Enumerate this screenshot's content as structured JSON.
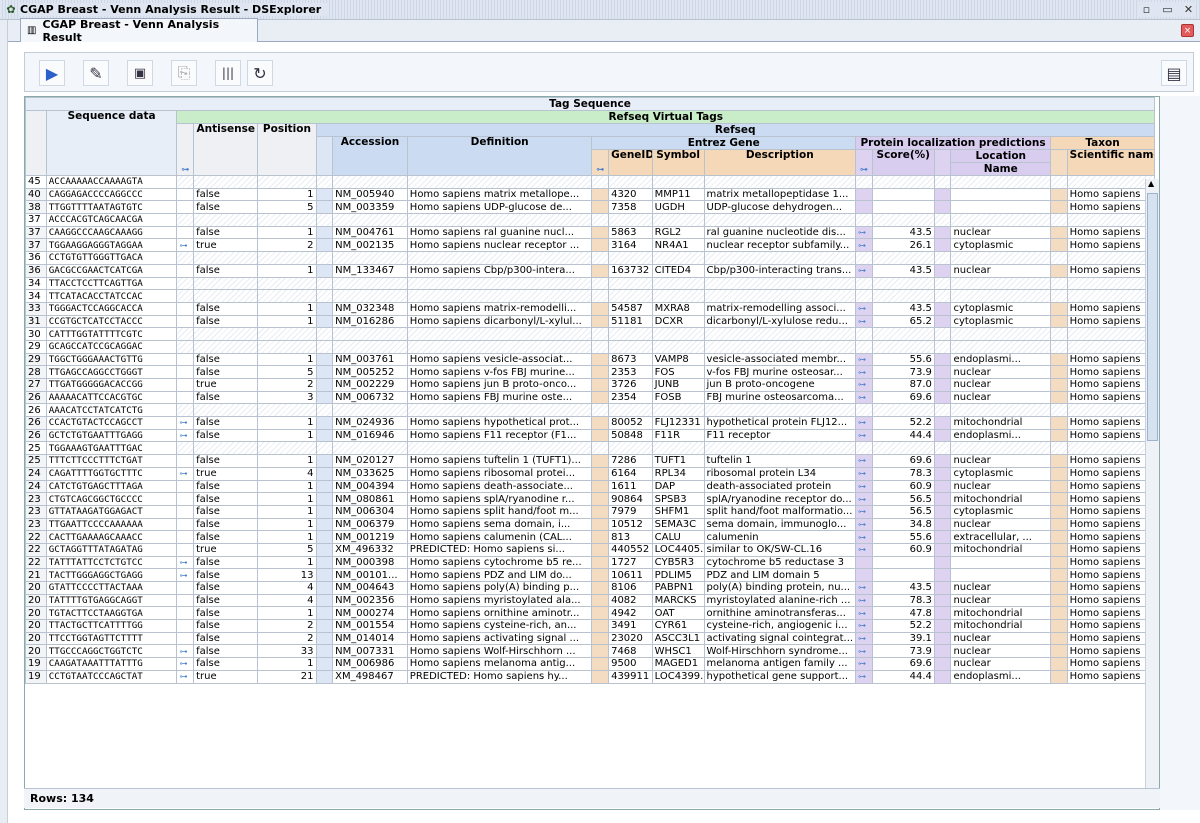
{
  "window": {
    "title": "CGAP Breast - Venn Analysis Result - DSExplorer"
  },
  "tab": {
    "label": "CGAP Breast - Venn Analysis Result"
  },
  "toolbar": {
    "buttons": [
      {
        "name": "run-icon",
        "glyph": "▶"
      },
      {
        "name": "edit-icon",
        "glyph": "✎"
      },
      {
        "name": "save-icon",
        "glyph": "💾"
      },
      {
        "name": "copy-icon",
        "glyph": "⎘"
      },
      {
        "name": "barcode-icon",
        "glyph": "|||"
      },
      {
        "name": "refresh-icon",
        "glyph": "↻"
      }
    ],
    "panel_icon": "▤"
  },
  "headers": {
    "tag_sequence": "Tag Sequence",
    "sequence_data": "Sequence data",
    "refseq_virtual_tags": "Refseq Virtual Tags",
    "antisense": "Antisense",
    "position": "Position",
    "refseq": "Refseq",
    "accession": "Accession",
    "definition": "Definition",
    "entrez_gene": "Entrez Gene",
    "geneid": "GeneID",
    "symbol": "Symbol",
    "description": "Description",
    "protein_loc": "Protein localization predictions",
    "score": "Score(%)",
    "location": "Location",
    "name": "Name",
    "taxon": "Taxon",
    "scientific_name": "Scientific name"
  },
  "rows": [
    [
      "45",
      "ACCAAAAACCAAAAGTA",
      "",
      "",
      "",
      "",
      "",
      "",
      "",
      "",
      "",
      "",
      ""
    ],
    [
      "40",
      "CAGGAGACCCCAGGCCC",
      "false",
      "1",
      "NM_005940",
      "Homo sapiens matrix metallope...",
      "4320",
      "MMP11",
      "matrix metallopeptidase 1...",
      "",
      "",
      "",
      "Homo sapiens"
    ],
    [
      "38",
      "TTGGTTTTAATAGTGTC",
      "false",
      "5",
      "NM_003359",
      "Homo sapiens UDP-glucose de...",
      "7358",
      "UGDH",
      "UDP-glucose dehydrogen...",
      "",
      "",
      "",
      "Homo sapiens"
    ],
    [
      "37",
      "ACCCACGTCAGCAACGA",
      "",
      "",
      "",
      "",
      "",
      "",
      "",
      "",
      "",
      "",
      ""
    ],
    [
      "37",
      "CAAGGCCCAAGCAAAGG",
      "false",
      "1",
      "NM_004761",
      "Homo sapiens ral guanine nucl...",
      "5863",
      "RGL2",
      "ral guanine nucleotide dis...",
      "k",
      "43.5",
      "nuclear",
      "Homo sapiens"
    ],
    [
      "37",
      "TGGAAGGAGGGTAGGAA",
      "true",
      "2",
      "NM_002135",
      "Homo sapiens nuclear receptor ...",
      "3164",
      "NR4A1",
      "nuclear receptor subfamily...",
      "k",
      "26.1",
      "cytoplasmic",
      "Homo sapiens"
    ],
    [
      "36",
      "CCTGTGTTGGGTTGACA",
      "",
      "",
      "",
      "",
      "",
      "",
      "",
      "",
      "",
      "",
      ""
    ],
    [
      "36",
      "GACGCCGAACTCATCGA",
      "false",
      "1",
      "NM_133467",
      "Homo sapiens Cbp/p300-intera...",
      "163732",
      "CITED4",
      "Cbp/p300-interacting trans...",
      "k",
      "43.5",
      "nuclear",
      "Homo sapiens"
    ],
    [
      "34",
      "TTACCTCCTTCAGTTGA",
      "",
      "",
      "",
      "",
      "",
      "",
      "",
      "",
      "",
      "",
      ""
    ],
    [
      "34",
      "TTCATACACCTATCCAC",
      "",
      "",
      "",
      "",
      "",
      "",
      "",
      "",
      "",
      "",
      ""
    ],
    [
      "33",
      "TGGGACTCCAGGCACCA",
      "false",
      "1",
      "NM_032348",
      "Homo sapiens matrix-remodelli...",
      "54587",
      "MXRA8",
      "matrix-remodelling associ...",
      "k",
      "43.5",
      "cytoplasmic",
      "Homo sapiens"
    ],
    [
      "31",
      "CCGTGCTCATCCTACCC",
      "false",
      "1",
      "NM_016286",
      "Homo sapiens dicarbonyl/L-xylul...",
      "51181",
      "DCXR",
      "dicarbonyl/L-xylulose redu...",
      "k",
      "65.2",
      "cytoplasmic",
      "Homo sapiens"
    ],
    [
      "30",
      "CATTTGGTATTTTCGTC",
      "",
      "",
      "",
      "",
      "",
      "",
      "",
      "",
      "",
      "",
      ""
    ],
    [
      "29",
      "GCAGCCATCCGCAGGAC",
      "",
      "",
      "",
      "",
      "",
      "",
      "",
      "",
      "",
      "",
      ""
    ],
    [
      "29",
      "TGGCTGGGAAACTGTTG",
      "false",
      "1",
      "NM_003761",
      "Homo sapiens vesicle-associat...",
      "8673",
      "VAMP8",
      "vesicle-associated membr...",
      "k",
      "55.6",
      "endoplasmi...",
      "Homo sapiens"
    ],
    [
      "28",
      "TTGAGCCAGGCCTGGGT",
      "false",
      "5",
      "NM_005252",
      "Homo sapiens v-fos FBJ murine...",
      "2353",
      "FOS",
      "v-fos FBJ murine osteosar...",
      "k",
      "73.9",
      "nuclear",
      "Homo sapiens"
    ],
    [
      "27",
      "TTGATGGGGGACACCGG",
      "true",
      "2",
      "NM_002229",
      "Homo sapiens jun B proto-onco...",
      "3726",
      "JUNB",
      "jun B proto-oncogene",
      "k",
      "87.0",
      "nuclear",
      "Homo sapiens"
    ],
    [
      "26",
      "AAAAACATTCCACGTGC",
      "false",
      "3",
      "NM_006732",
      "Homo sapiens FBJ murine oste...",
      "2354",
      "FOSB",
      "FBJ murine osteosarcoma...",
      "k",
      "69.6",
      "nuclear",
      "Homo sapiens"
    ],
    [
      "26",
      "AAACATCCTATCATCTG",
      "",
      "",
      "",
      "",
      "",
      "",
      "",
      "",
      "",
      "",
      ""
    ],
    [
      "26",
      "CCACTGTACTCCAGCCT",
      "false",
      "1",
      "NM_024936",
      "Homo sapiens hypothetical prot...",
      "80052",
      "FLJ12331",
      "hypothetical protein FLJ12...",
      "k",
      "52.2",
      "mitochondrial",
      "Homo sapiens"
    ],
    [
      "26",
      "GCTCTGTGAATTTGAGG",
      "false",
      "1",
      "NM_016946",
      "Homo sapiens F11 receptor (F1...",
      "50848",
      "F11R",
      "F11 receptor",
      "k",
      "44.4",
      "endoplasmi...",
      "Homo sapiens"
    ],
    [
      "25",
      "TGGAAAGTGAATTTGAC",
      "",
      "",
      "",
      "",
      "",
      "",
      "",
      "",
      "",
      "",
      ""
    ],
    [
      "25",
      "TTTCTTCCCTTTCTGAT",
      "false",
      "1",
      "NM_020127",
      "Homo sapiens tuftelin 1 (TUFT1)...",
      "7286",
      "TUFT1",
      "tuftelin 1",
      "k",
      "69.6",
      "nuclear",
      "Homo sapiens"
    ],
    [
      "24",
      "CAGATTTTGGTGCTTTC",
      "true",
      "4",
      "NM_033625",
      "Homo sapiens ribosomal protei...",
      "6164",
      "RPL34",
      "ribosomal protein L34",
      "k",
      "78.3",
      "cytoplasmic",
      "Homo sapiens"
    ],
    [
      "24",
      "CATCTGTGAGCTTTAGA",
      "false",
      "1",
      "NM_004394",
      "Homo sapiens death-associate...",
      "1611",
      "DAP",
      "death-associated protein",
      "k",
      "60.9",
      "nuclear",
      "Homo sapiens"
    ],
    [
      "23",
      "CTGTCAGCGGCTGCCCC",
      "false",
      "1",
      "NM_080861",
      "Homo sapiens splA/ryanodine r...",
      "90864",
      "SPSB3",
      "splA/ryanodine receptor do...",
      "k",
      "56.5",
      "mitochondrial",
      "Homo sapiens"
    ],
    [
      "23",
      "GTTATAAGATGGAGACT",
      "false",
      "1",
      "NM_006304",
      "Homo sapiens split hand/foot m...",
      "7979",
      "SHFM1",
      "split hand/foot malformatio...",
      "k",
      "56.5",
      "cytoplasmic",
      "Homo sapiens"
    ],
    [
      "23",
      "TTGAATTCCCCAAAAAA",
      "false",
      "1",
      "NM_006379",
      "Homo sapiens sema domain, i...",
      "10512",
      "SEMA3C",
      "sema domain, immunoglo...",
      "k",
      "34.8",
      "nuclear",
      "Homo sapiens"
    ],
    [
      "22",
      "CACTTGAAAAGCAAACC",
      "false",
      "1",
      "NM_001219",
      "Homo sapiens calumenin (CAL...",
      "813",
      "CALU",
      "calumenin",
      "k",
      "55.6",
      "extracellular, ...",
      "Homo sapiens"
    ],
    [
      "22",
      "GCTAGGTTTATAGATAG",
      "true",
      "5",
      "XM_496332",
      "PREDICTED: Homo sapiens si...",
      "440552",
      "LOC4405...",
      "similar to OK/SW-CL.16",
      "k",
      "60.9",
      "mitochondrial",
      "Homo sapiens"
    ],
    [
      "22",
      "TATTTATTCCTCTGTCC",
      "false",
      "1",
      "NM_000398",
      "Homo sapiens cytochrome b5 re...",
      "1727",
      "CYB5R3",
      "cytochrome b5 reductase 3",
      "",
      "",
      "",
      "Homo sapiens"
    ],
    [
      "21",
      "TACTTGGGAGGCTGAGG",
      "false",
      "13",
      "NM_00101...",
      "Homo sapiens PDZ and LIM do...",
      "10611",
      "PDLIM5",
      "PDZ and LIM domain 5",
      "",
      "",
      "",
      "Homo sapiens"
    ],
    [
      "20",
      "GTATTCCCCTTACTAAA",
      "false",
      "4",
      "NM_004643",
      "Homo sapiens poly(A) binding p...",
      "8106",
      "PABPN1",
      "poly(A) binding protein, nu...",
      "k",
      "43.5",
      "nuclear",
      "Homo sapiens"
    ],
    [
      "20",
      "TATTTTGTGAGGCAGGT",
      "false",
      "4",
      "NM_002356",
      "Homo sapiens myristoylated ala...",
      "4082",
      "MARCKS",
      "myristoylated alanine-rich ...",
      "k",
      "78.3",
      "nuclear",
      "Homo sapiens"
    ],
    [
      "20",
      "TGTACTTCCTAAGGTGA",
      "false",
      "1",
      "NM_000274",
      "Homo sapiens ornithine aminotr...",
      "4942",
      "OAT",
      "ornithine aminotransferas...",
      "k",
      "47.8",
      "mitochondrial",
      "Homo sapiens"
    ],
    [
      "20",
      "TTACTGCTTCATTTTGG",
      "false",
      "2",
      "NM_001554",
      "Homo sapiens cysteine-rich, an...",
      "3491",
      "CYR61",
      "cysteine-rich, angiogenic i...",
      "k",
      "52.2",
      "mitochondrial",
      "Homo sapiens"
    ],
    [
      "20",
      "TTCCTGGTAGTTCTTTT",
      "false",
      "2",
      "NM_014014",
      "Homo sapiens activating signal ...",
      "23020",
      "ASCC3L1",
      "activating signal cointegrat...",
      "k",
      "39.1",
      "nuclear",
      "Homo sapiens"
    ],
    [
      "20",
      "TTGCCCAGGCTGGTCTC",
      "false",
      "33",
      "NM_007331",
      "Homo sapiens Wolf-Hirschhorn ...",
      "7468",
      "WHSC1",
      "Wolf-Hirschhorn syndrome...",
      "k",
      "73.9",
      "nuclear",
      "Homo sapiens"
    ],
    [
      "19",
      "CAAGATAAATTTATTTG",
      "false",
      "1",
      "NM_006986",
      "Homo sapiens melanoma antig...",
      "9500",
      "MAGED1",
      "melanoma antigen family ...",
      "k",
      "69.6",
      "nuclear",
      "Homo sapiens"
    ],
    [
      "19",
      "CCTGTAATCCCAGCTAT",
      "true",
      "21",
      "XM_498467",
      "PREDICTED: Homo sapiens hy...",
      "439911",
      "LOC4399...",
      "hypothetical gene support...",
      "k",
      "44.4",
      "endoplasmi...",
      "Homo sapiens"
    ]
  ],
  "key_rows": [
    1,
    4,
    5,
    7,
    10,
    11,
    14,
    15,
    16,
    17,
    19,
    20,
    22,
    23,
    24,
    25,
    26,
    27,
    28,
    29,
    30,
    33,
    34,
    35,
    36,
    37,
    38,
    39
  ],
  "antisense_key_rows": [
    5,
    19,
    20,
    23,
    30,
    31,
    37,
    38,
    39
  ],
  "status": {
    "rows_label": "Rows: 134"
  }
}
